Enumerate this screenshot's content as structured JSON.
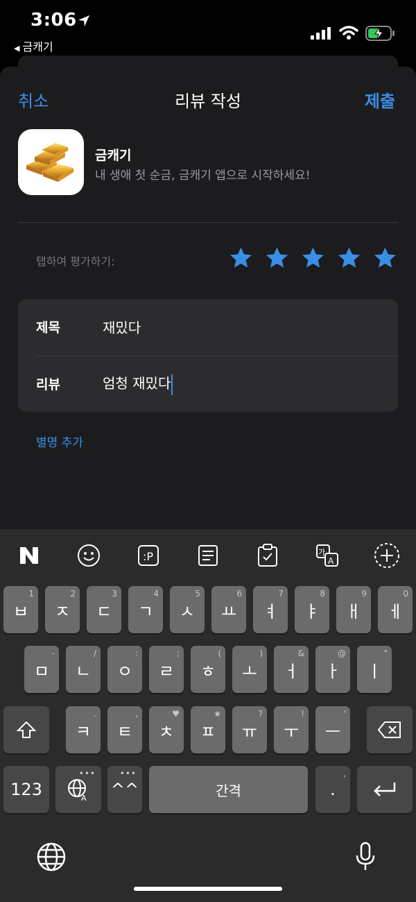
{
  "status_bar": {
    "time": "3:06",
    "back_app": "금캐기"
  },
  "header": {
    "cancel_label": "취소",
    "title": "리뷰 작성",
    "submit_label": "제출"
  },
  "app": {
    "name": "금캐기",
    "description": "내 생애 첫 순금, 금캐기 앱으로 시작하세요!"
  },
  "rating": {
    "label": "탭하여 평가하기:",
    "stars_selected": 5,
    "stars_total": 5,
    "color": "#3a8ee6"
  },
  "form": {
    "title_label": "제목",
    "title_value": "재밌다",
    "review_label": "리뷰",
    "review_value": "엄청 재밌다"
  },
  "alias_link": "별명 추가",
  "keyboard": {
    "toolbar": [
      "naver-icon",
      "emoji-icon",
      "clipboard-p-icon",
      "memo-icon",
      "clipboard-check-icon",
      "translate-icon",
      "add-icon"
    ],
    "row1": [
      {
        "key": "ㅂ",
        "hint": "1"
      },
      {
        "key": "ㅈ",
        "hint": "2"
      },
      {
        "key": "ㄷ",
        "hint": "3"
      },
      {
        "key": "ㄱ",
        "hint": "4"
      },
      {
        "key": "ㅅ",
        "hint": "5"
      },
      {
        "key": "ㅛ",
        "hint": "6"
      },
      {
        "key": "ㅕ",
        "hint": "7"
      },
      {
        "key": "ㅑ",
        "hint": "8"
      },
      {
        "key": "ㅐ",
        "hint": "9"
      },
      {
        "key": "ㅔ",
        "hint": "0"
      }
    ],
    "row2": [
      {
        "key": "ㅁ",
        "hint": "-"
      },
      {
        "key": "ㄴ",
        "hint": "/"
      },
      {
        "key": "ㅇ",
        "hint": ":"
      },
      {
        "key": "ㄹ",
        "hint": ";"
      },
      {
        "key": "ㅎ",
        "hint": "("
      },
      {
        "key": "ㅗ",
        "hint": ")"
      },
      {
        "key": "ㅓ",
        "hint": "&"
      },
      {
        "key": "ㅏ",
        "hint": "@"
      },
      {
        "key": "ㅣ",
        "hint": "\""
      }
    ],
    "row3": [
      {
        "key": "ㅋ",
        "hint": "."
      },
      {
        "key": "ㅌ",
        "hint": ","
      },
      {
        "key": "ㅊ",
        "hint": "♥"
      },
      {
        "key": "ㅍ",
        "hint": "★"
      },
      {
        "key": "ㅠ",
        "hint": "?"
      },
      {
        "key": "ㅜ",
        "hint": "!"
      },
      {
        "key": "ㅡ",
        "hint": "'"
      }
    ],
    "num_label": "123",
    "caret_label": "^^",
    "space_label": "간격",
    "period_label": ".",
    "period_hint": ","
  }
}
